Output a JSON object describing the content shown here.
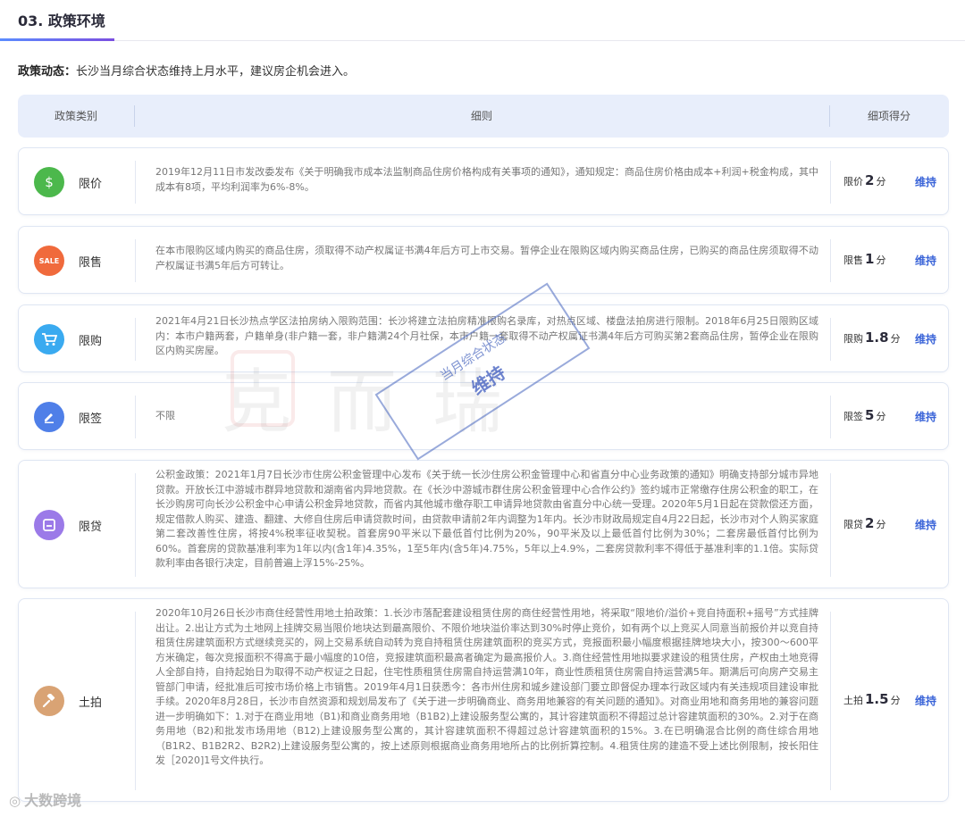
{
  "section": {
    "title": "03. 政策环境"
  },
  "dynamic": {
    "label": "政策动态：",
    "text": "长沙当月综合状态维持上月水平，建议房企机会进入。"
  },
  "table_headers": {
    "category": "政策类别",
    "detail": "细则",
    "score": "细项得分"
  },
  "rows": [
    {
      "icon": "money-bag-icon",
      "color": "#4cb84c",
      "glyph": "$",
      "category": "限价",
      "detail": "2019年12月11日市发改委发布《关于明确我市成本法监制商品住房价格构成有关事项的通知》，通知规定：商品住房价格由成本+利润+税金构成，其中成本有8项，平均利润率为6%-8%。",
      "score_label": "限价",
      "score": "2",
      "unit": "分",
      "status": "维持"
    },
    {
      "icon": "sale-tag-icon",
      "color": "#f06a3c",
      "glyph": "SALE",
      "category": "限售",
      "detail": "在本市限购区域内购买的商品住房，须取得不动产权属证书满4年后方可上市交易。暂停企业在限购区域内购买商品住房，已购买的商品住房须取得不动产权属证书满5年后方可转让。",
      "score_label": "限售",
      "score": "1",
      "unit": "分",
      "status": "维持"
    },
    {
      "icon": "shopping-cart-icon",
      "color": "#3aaaf0",
      "glyph": "🛒",
      "category": "限购",
      "detail": "2021年4月21日长沙热点学区法拍房纳入限购范围：长沙将建立法拍房精准限购名录库，对热点区域、楼盘法拍房进行限制。2018年6月25日限购区域内：本市户籍两套，户籍单身(非户籍一套，非户籍满24个月社保，本市户籍一套取得不动产权属证书满4年后方可购买第2套商品住房，暂停企业在限购区内购买房屋。",
      "score_label": "限购",
      "score": "1.8",
      "unit": "分",
      "status": "维持"
    },
    {
      "icon": "pencil-sign-icon",
      "color": "#4f7fe8",
      "glyph": "✎",
      "category": "限签",
      "detail": "不限",
      "score_label": "限签",
      "score": "5",
      "unit": "分",
      "status": "维持"
    },
    {
      "icon": "loan-card-icon",
      "color": "#9b7ae8",
      "glyph": "▣",
      "category": "限贷",
      "detail": "公积金政策：2021年1月7日长沙市住房公积金管理中心发布《关于统一长沙住房公积金管理中心和省直分中心业务政策的通知》明确支持部分城市异地贷款。开放长江中游城市群异地贷款和湖南省内异地贷款。在《长沙中游城市群住房公积金管理中心合作公约》签约城市正常缴存住房公积金的职工，在长沙购房可向长沙公积金中心申请公积金异地贷款，而省内其他城市缴存职工申请异地贷款由省直分中心统一受理。2020年5月1日起在贷款偿还方面，规定借款人购买、建造、翻建、大修自住房后申请贷款时间，由贷款申请前2年内调整为1年内。长沙市财政局规定自4月22日起，长沙市对个人购买家庭第二套改善性住房，将按4%税率征收契税。首套房90平米以下最低首付比例为20%，90平米及以上最低首付比例为30%；二套房最低首付比例为60%。首套房的贷款基准利率为1年以内(含1年)4.35%，1至5年内(含5年)4.75%，5年以上4.9%，二套房贷款利率不得低于基准利率的1.1倍。实际贷款利率由各银行决定，目前普遍上浮15%-25%。",
      "score_label": "限贷",
      "score": "2",
      "unit": "分",
      "status": "维持"
    },
    {
      "icon": "auction-hammer-icon",
      "color": "#d9a374",
      "glyph": "⚒",
      "category": "土拍",
      "detail": "2020年10月26日长沙市商住经营性用地土拍政策：1.长沙市落配套建设租赁住房的商住经营性用地，将采取“限地价/溢价+竞自持面积+摇号”方式挂牌出让。2.出让方式为土地网上挂牌交易当限价地块达到最高限价、不限价地块溢价率达到30%时停止竞价，如有两个以上竞买人同意当前报价并以竞自持租赁住房建筑面积方式继续竞买的，网上交易系统自动转为竞自持租赁住房建筑面积的竞买方式，竞报面积最小幅度根据挂牌地块大小，按300～600平方米确定，每次竞报面积不得高于最小幅度的10倍，竞报建筑面积最高者确定为最高报价人。3.商住经营性用地拟要求建设的租赁住房，产权由土地竞得人全部自持，自持起始日为取得不动产权证之日起，住宅性质租赁住房需自持运营满10年，商业性质租赁住房需自持运营满5年。期满后可向房产交易主管部门申请，经批准后可按市场价格上市销售。2019年4月1日获悉今：各市州住房和城乡建设部门要立即督促办理本行政区域内有关违规项目建设审批手续。2020年8月28日，长沙市自然资源和规划局发布了《关于进一步明确商业、商务用地兼容的有关问题的通知》。对商业用地和商务用地的兼容问题进一步明确如下：1.对于在商业用地（B1)和商业商务用地（B1B2)上建设服务型公寓的，其计容建筑面积不得超过总计容建筑面积的30%。2.对于在商务用地（B2)和批发市场用地（B12)上建设服务型公寓的，其计容建筑面积不得超过总计容建筑面积的15%。3.在已明确混合比例的商住综合用地（B1R2、B1B2R2、B2R2)上建设服务型公寓的，按上述原则根据商业商务用地所占的比例折算控制。4.租赁住房的建造不受上述比例限制，按长阳住发［2020]1号文件执行。",
      "score_label": "土拍",
      "score": "1.5",
      "unit": "分",
      "status": "维持"
    }
  ],
  "stamp": {
    "top": "当月综合状态",
    "main": "维持"
  },
  "watermark": {
    "text": "克而瑞"
  },
  "footer": {
    "text": "大数跨境"
  }
}
